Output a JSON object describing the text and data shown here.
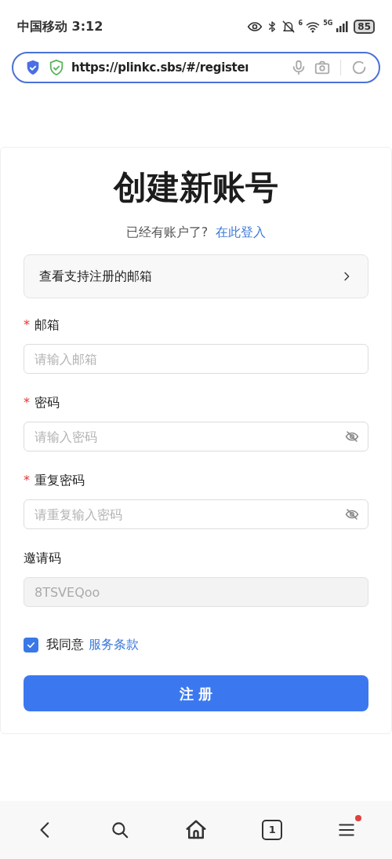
{
  "status_bar": {
    "carrier_time": "中国移动 3:12",
    "wifi_label": "6",
    "network": "5G",
    "battery": "85"
  },
  "address_bar": {
    "url": "https://plinkc.sbs/#/registeı"
  },
  "form": {
    "title": "创建新账号",
    "login_prompt": "已经有账户了?",
    "login_link": "在此登入",
    "supported_mail": "查看支持注册的邮箱",
    "fields": [
      {
        "label": "邮箱",
        "required_mark": "*",
        "kind": "text",
        "placeholder": "请输入邮箱",
        "disabled": false
      },
      {
        "label": "密码",
        "required_mark": "*",
        "kind": "password",
        "placeholder": "请输入密码",
        "disabled": false
      },
      {
        "label": "重复密码",
        "required_mark": "*",
        "kind": "password",
        "placeholder": "请重复输入密码",
        "disabled": false
      },
      {
        "label": "邀请码",
        "kind": "text",
        "value": "8TSVEQoo",
        "disabled": true
      }
    ],
    "agree": {
      "checked": true,
      "text": "我同意",
      "link": "服务条款"
    },
    "submit": "注 册"
  },
  "bottom_nav": {
    "tabs_count": "1"
  }
}
